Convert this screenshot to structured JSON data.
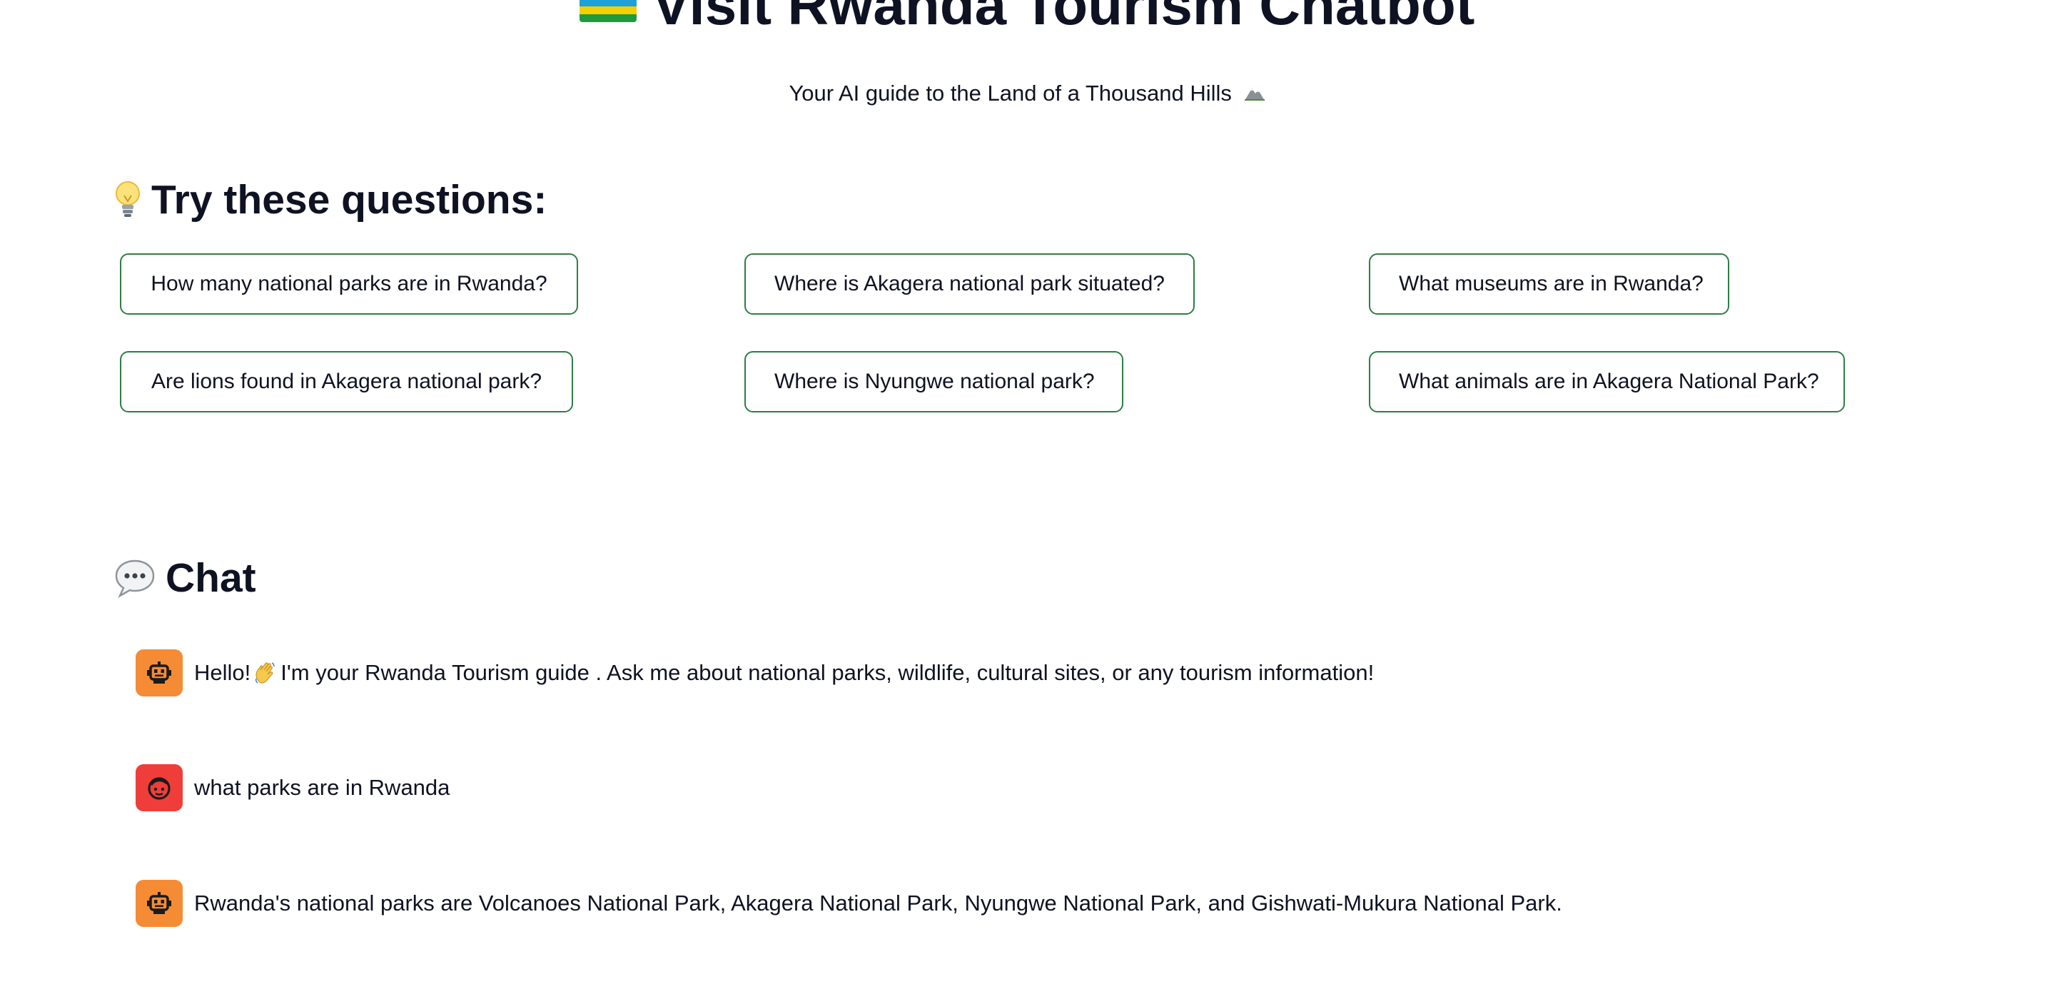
{
  "header": {
    "title": "Visit Rwanda Tourism Chatbot",
    "flag_icon": "rwanda-flag-icon",
    "subtitle": "Your AI guide to the Land of a Thousand Hills",
    "subtitle_icon": "mountain-icon"
  },
  "suggestions": {
    "heading": "Try these questions:",
    "heading_icon": "lightbulb-icon",
    "button_border_color": "#2e7d46",
    "questions": [
      "How many national parks are in Rwanda?",
      "Where is Akagera national park situated?",
      "What museums are in Rwanda?",
      "Are lions found in Akagera national park?",
      "Where is Nyungwe national park?",
      "What animals are in Akagera National Park?"
    ]
  },
  "chat": {
    "heading": "Chat",
    "heading_icon": "speech-bubble-icon",
    "bot_avatar_color": "#f58b35",
    "user_avatar_color": "#ef3e3a",
    "messages": [
      {
        "role": "bot",
        "avatar_icon": "robot-icon",
        "text_before": "Hello!",
        "inline_icon": "waving-hand-icon",
        "text_after": "I'm your Rwanda Tourism guide . Ask me about national parks, wildlife, cultural sites, or any tourism information!"
      },
      {
        "role": "user",
        "avatar_icon": "face-icon",
        "text": "what parks are in Rwanda"
      },
      {
        "role": "bot",
        "avatar_icon": "robot-icon",
        "text": "Rwanda's national parks are Volcanoes National Park, Akagera National Park, Nyungwe National Park, and Gishwati-Mukura National Park."
      }
    ]
  }
}
